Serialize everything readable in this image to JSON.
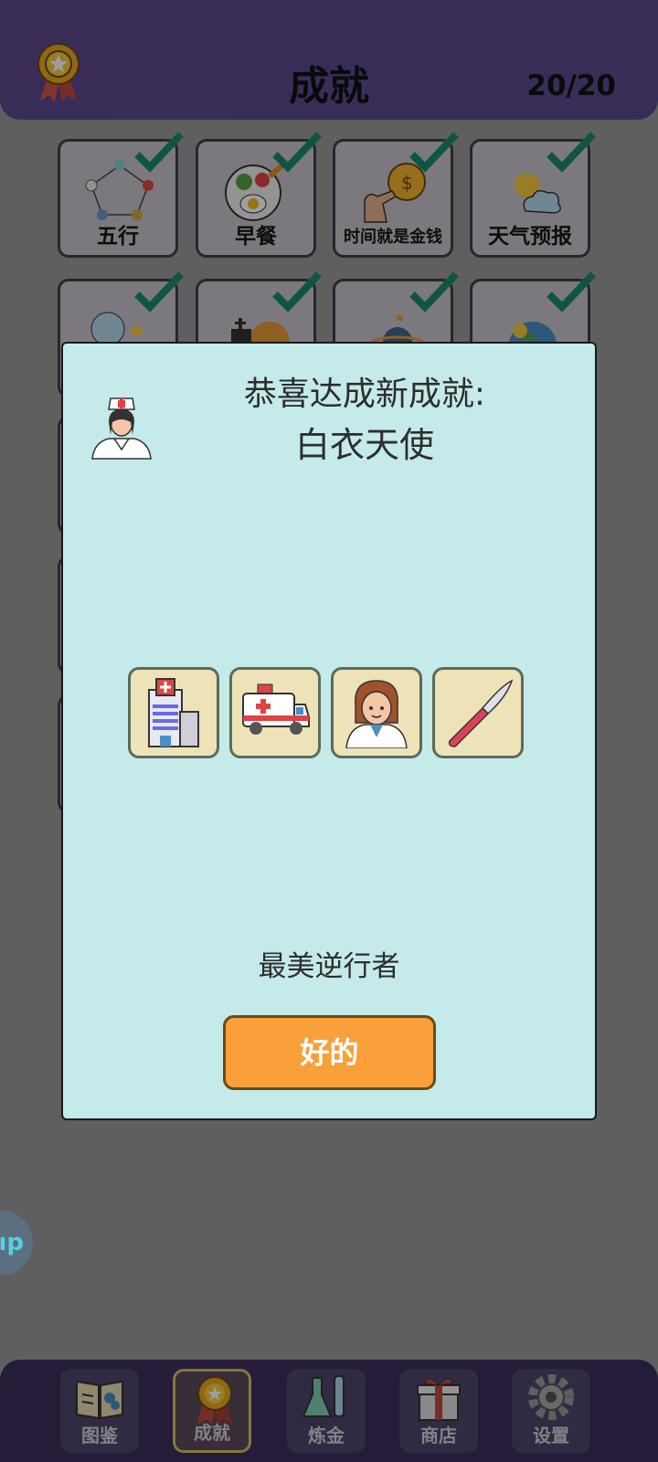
{
  "header": {
    "title": "成就",
    "count": "20/20",
    "medal_icon": "medal-icon"
  },
  "achievements": [
    {
      "label": "五行",
      "icon": "five-elements-icon",
      "done": true
    },
    {
      "label": "早餐",
      "icon": "breakfast-icon",
      "done": true
    },
    {
      "label": "时间就是金钱",
      "icon": "coin-hand-icon",
      "done": true
    },
    {
      "label": "天气预报",
      "icon": "weather-icon",
      "done": true
    },
    {
      "label": "",
      "icon": "island-icon",
      "done": true
    },
    {
      "label": "",
      "icon": "night-church-icon",
      "done": true
    },
    {
      "label": "",
      "icon": "planet-icon",
      "done": true
    },
    {
      "label": "",
      "icon": "earth-icon",
      "done": true
    }
  ],
  "modal": {
    "line1": "恭喜达成新成就:",
    "line2": "白衣天使",
    "achievement_icon": "nurse-icon",
    "recipe": [
      {
        "icon": "hospital-icon"
      },
      {
        "icon": "ambulance-icon"
      },
      {
        "icon": "doctor-icon"
      },
      {
        "icon": "scalpel-icon"
      }
    ],
    "description": "最美逆行者",
    "ok_label": "好的"
  },
  "help_button": {
    "label": "ıp"
  },
  "nav": [
    {
      "label": "图鉴",
      "icon": "book-icon",
      "active": false
    },
    {
      "label": "成就",
      "icon": "medal-icon",
      "active": true
    },
    {
      "label": "炼金",
      "icon": "flask-icon",
      "active": false
    },
    {
      "label": "商店",
      "icon": "gift-icon",
      "active": false
    },
    {
      "label": "设置",
      "icon": "gear-icon",
      "active": false
    }
  ],
  "colors": {
    "header_bg": "#5c4a8e",
    "modal_bg": "#c5eaea",
    "ok_button": "#f9a03a",
    "check": "#1a8a6e"
  }
}
